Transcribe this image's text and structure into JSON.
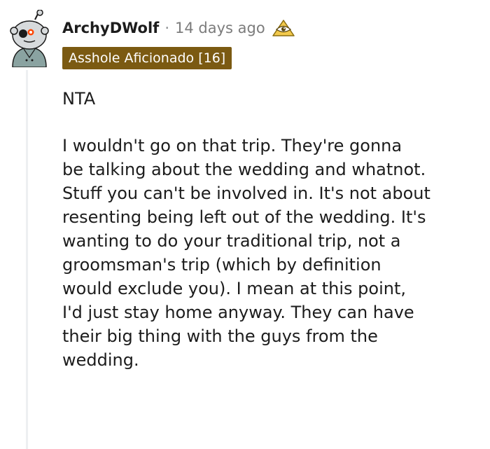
{
  "comment": {
    "username": "ArchyDWolf",
    "separator": "·",
    "timestamp": "14 days ago",
    "award_icon": "eye-pyramid-award",
    "flair": "Asshole Aficionado [16]",
    "flair_color": "#7b5a12",
    "body_lines": [
      "NTA",
      "I wouldn't go on that trip. They're gonna",
      "be talking about the wedding and whatnot.",
      "Stuff you can't be involved in. It's not about",
      "resenting being left out of the wedding. It's",
      "wanting to do your traditional trip, not a",
      "groomsman's trip (which by definition",
      "would exclude you). I mean at this point,",
      "I'd just stay home anyway. They can have",
      "their big thing with the guys from the",
      "wedding."
    ]
  }
}
